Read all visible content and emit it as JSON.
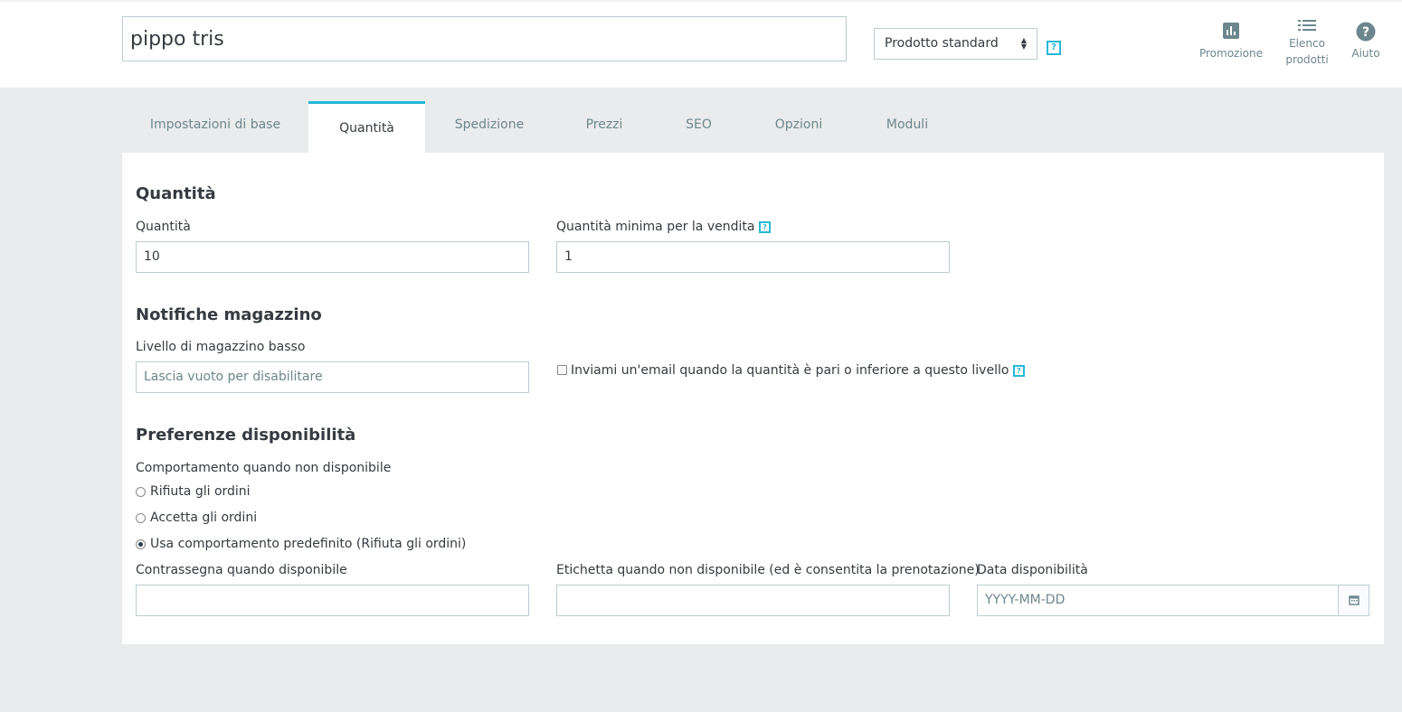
{
  "header": {
    "product_name": "pippo tris",
    "product_type": "Prodotto standard",
    "help_glyph": "?",
    "toolbar": [
      {
        "label": "Promozione",
        "icon": "bar-chart-icon"
      },
      {
        "label": "Elenco",
        "label2": "prodotti",
        "icon": "list-icon"
      },
      {
        "label": "Aiuto",
        "icon": "help-circle-icon"
      }
    ]
  },
  "tabs": [
    {
      "label": "Impostazioni di base"
    },
    {
      "label": "Quantità",
      "active": true
    },
    {
      "label": "Spedizione"
    },
    {
      "label": "Prezzi"
    },
    {
      "label": "SEO"
    },
    {
      "label": "Opzioni"
    },
    {
      "label": "Moduli"
    }
  ],
  "quantity": {
    "title": "Quantità",
    "qty_label": "Quantità",
    "qty_value": "10",
    "min_label": "Quantità minima per la vendita",
    "min_value": "1"
  },
  "stock": {
    "title": "Notifiche magazzino",
    "low_label": "Livello di magazzino basso",
    "low_placeholder": "Lascia vuoto per disabilitare",
    "email_label": "Inviami un'email quando la quantità è pari o inferiore a questo livello",
    "email_checked": false
  },
  "availability": {
    "title": "Preferenze disponibilità",
    "behavior_label": "Comportamento quando non disponibile",
    "options": [
      {
        "label": "Rifiuta gli ordini",
        "checked": false
      },
      {
        "label": "Accetta gli ordini",
        "checked": false
      },
      {
        "label": "Usa comportamento predefinito (Rifiuta gli ordini)",
        "checked": true
      }
    ],
    "in_stock_label": "Contrassegna quando disponibile",
    "in_stock_value": "",
    "out_stock_label": "Etichetta quando non disponibile (ed è consentita la prenotazione)",
    "out_stock_value": "",
    "date_label": "Data disponibilità",
    "date_placeholder": "YYYY-MM-DD"
  },
  "colors": {
    "accent": "#25b9d7",
    "page_bg": "#eaebec",
    "text": "#363a41",
    "muted": "#6c868e",
    "border": "#bbcdd2"
  }
}
